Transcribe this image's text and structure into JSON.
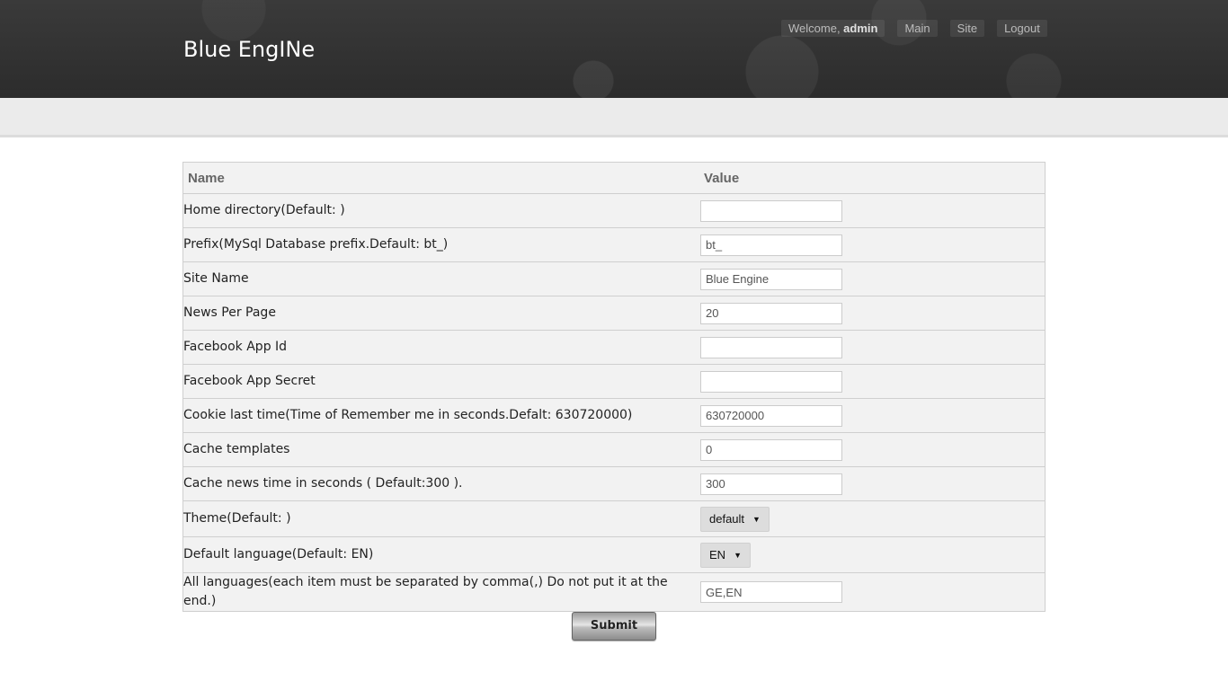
{
  "header": {
    "site_title": "Blue EngINe",
    "welcome_text": "Welcome, ",
    "username": "admin",
    "nav": [
      "Main",
      "Site",
      "Logout"
    ]
  },
  "table": {
    "headers": {
      "name": "Name",
      "value": "Value"
    },
    "rows": [
      {
        "name": "Home directory(Default: )",
        "value": ""
      },
      {
        "name": "Prefix(MySql Database prefix.Default: bt_)",
        "value": "bt_"
      },
      {
        "name": "Site Name",
        "value": "Blue Engine"
      },
      {
        "name": "News Per Page",
        "value": "20"
      },
      {
        "name": "Facebook App Id",
        "value": ""
      },
      {
        "name": "Facebook App Secret",
        "value": ""
      },
      {
        "name": "Cookie last time(Time of Remember me in seconds.Defalt: 630720000)",
        "value": "630720000"
      },
      {
        "name": "Cache templates",
        "value": "0"
      },
      {
        "name": "Cache news time in seconds ( Default:300 ).",
        "value": "300"
      },
      {
        "name": "Theme(Default: )",
        "value": "default"
      },
      {
        "name": "Default language(Default: EN)",
        "value": "EN"
      },
      {
        "name": "All languages(each item must be separated by comma(,) Do not put it at the end.)",
        "value": "GE,EN"
      }
    ]
  },
  "submit_label": "Submit"
}
